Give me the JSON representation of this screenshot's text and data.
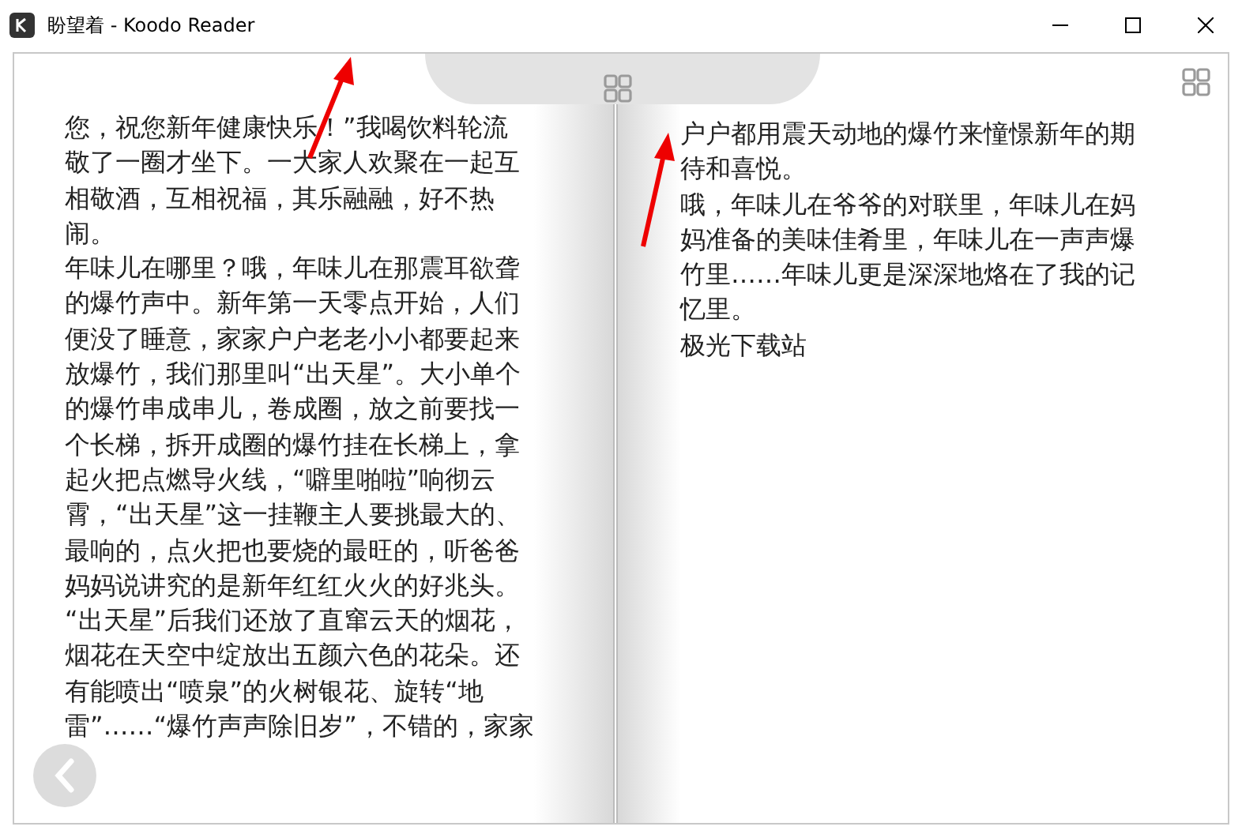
{
  "window": {
    "title": "盼望着 - Koodo Reader"
  },
  "pages": [
    {
      "lines": [
        "您，祝您新年健康快乐！”我喝饮料轮流",
        "敬了一圈才坐下。一大家人欢聚在一起互",
        "相敬酒，互相祝福，其乐融融，好不热",
        "闹。",
        "年味儿在哪里？哦，年味儿在那震耳欲聋",
        "的爆竹声中。新年第一天零点开始，人们",
        "便没了睡意，家家户户老老小小都要起来",
        "放爆竹，我们那里叫“出天星”。大小单个",
        "的爆竹串成串儿，卷成圈，放之前要找一",
        "个长梯，拆开成圈的爆竹挂在长梯上，拿",
        "起火把点燃导火线，“噼里啪啦”响彻云",
        "霄，“出天星”这一挂鞭主人要挑最大的、",
        "最响的，点火把也要烧的最旺的，听爸爸",
        "妈妈说讲究的是新年红红火火的好兆头。",
        "“出天星”后我们还放了直窜云天的烟花，",
        "烟花在天空中绽放出五颜六色的花朵。还",
        "有能喷出“喷泉”的火树银花、旋转“地",
        "雷”……“爆竹声声除旧岁”，不错的，家家"
      ]
    },
    {
      "lines": [
        "户户都用震天动地的爆竹来憧憬新年的期",
        "待和喜悦。",
        "哦，年味儿在爷爷的对联里，年味儿在妈",
        "妈准备的美味佳肴里，年味儿在一声声爆",
        "竹里……年味儿更是深深地烙在了我的记",
        "忆里。",
        "极光下载站"
      ]
    }
  ]
}
